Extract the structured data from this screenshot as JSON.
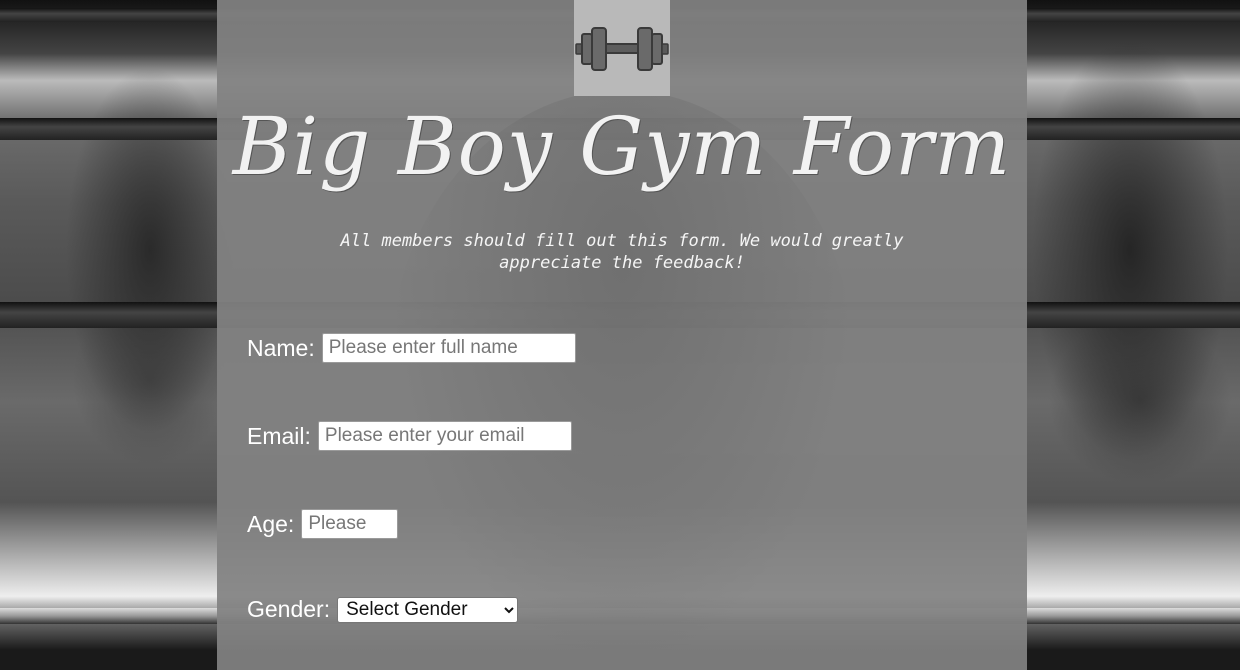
{
  "header": {
    "logo_icon": "dumbbell-icon",
    "title": "Big Boy Gym Form",
    "subtitle": "All members should fill out this form. We would greatly appreciate the feedback!"
  },
  "form": {
    "name": {
      "label": "Name:",
      "value": "",
      "placeholder": "Please enter full name"
    },
    "email": {
      "label": "Email:",
      "value": "",
      "placeholder": "Please enter your email"
    },
    "age": {
      "label": "Age:",
      "value": "",
      "placeholder": "Please"
    },
    "gender": {
      "label": "Gender:",
      "selected": "Select Gender"
    }
  },
  "colors": {
    "panel": "#828282",
    "logo_box": "#b9b9b9",
    "text": "#ffffff"
  }
}
